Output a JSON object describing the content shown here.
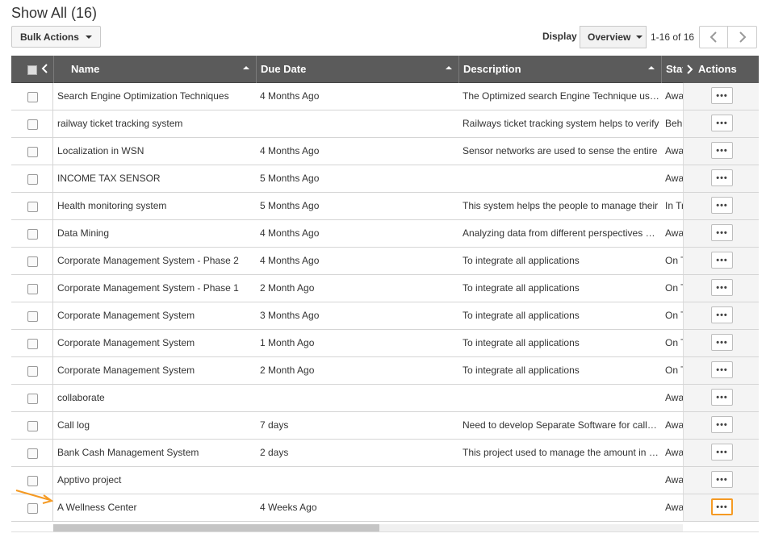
{
  "page": {
    "title": "Show All (16)"
  },
  "toolbar": {
    "bulk_actions": "Bulk Actions",
    "display_label": "Display",
    "view_select": "Overview",
    "pager_text": "1-16 of 16"
  },
  "columns": {
    "name": "Name",
    "due_date": "Due Date",
    "description": "Description",
    "status": "Status",
    "actions": "Actions"
  },
  "more_label": "•••",
  "rows": [
    {
      "name": "Search Engine Optimization Techniques",
      "due": "4 Months Ago",
      "desc": "The Optimized search Engine Technique used to",
      "status": "Awaiting"
    },
    {
      "name": "railway ticket tracking system",
      "due": "",
      "desc": "Railways ticket  tracking system helps to verify",
      "status": "Behind"
    },
    {
      "name": "Localization in WSN",
      "due": "4 Months Ago",
      "desc": "Sensor networks are used to sense the entire",
      "status": "Awaiting"
    },
    {
      "name": "INCOME TAX SENSOR",
      "due": "5 Months Ago",
      "desc": "",
      "status": "Awaiting"
    },
    {
      "name": "Health monitoring system",
      "due": "5 Months Ago",
      "desc": "This system helps the people to manage their",
      "status": "In Trouble"
    },
    {
      "name": "Data Mining",
      "due": "4 Months Ago",
      "desc": "Analyzing data from different perspectives and",
      "status": "Awaiting"
    },
    {
      "name": "Corporate Management System - Phase 2",
      "due": "4 Months Ago",
      "desc": "To integrate all applications",
      "status": "On Track"
    },
    {
      "name": "Corporate Management System - Phase 1",
      "due": "2 Month Ago",
      "desc": "To integrate all applications",
      "status": "On Track"
    },
    {
      "name": "Corporate Management System",
      "due": "3 Months Ago",
      "desc": "To integrate all applications",
      "status": "On Track"
    },
    {
      "name": "Corporate Management System",
      "due": "1 Month Ago",
      "desc": "To integrate all applications",
      "status": "On Track"
    },
    {
      "name": "Corporate Management System",
      "due": "2 Month Ago",
      "desc": "To integrate all applications",
      "status": "On Track"
    },
    {
      "name": "collaborate",
      "due": "",
      "desc": "",
      "status": "Awaiting"
    },
    {
      "name": "Call log",
      "due": "7 days",
      "desc": "Need to develop Separate  Software for call log",
      "status": "Awaiting"
    },
    {
      "name": "Bank Cash Management System",
      "due": "2 days",
      "desc": "This project used to manage the amount in bank",
      "status": "Awaiting"
    },
    {
      "name": "Apptivo project",
      "due": "",
      "desc": "",
      "status": "Awaiting"
    },
    {
      "name": "A Wellness Center",
      "due": "4 Weeks Ago",
      "desc": "",
      "status": "Awaiting"
    }
  ],
  "colors": {
    "header_bg": "#5b5b5b",
    "highlight": "#f59a23"
  }
}
